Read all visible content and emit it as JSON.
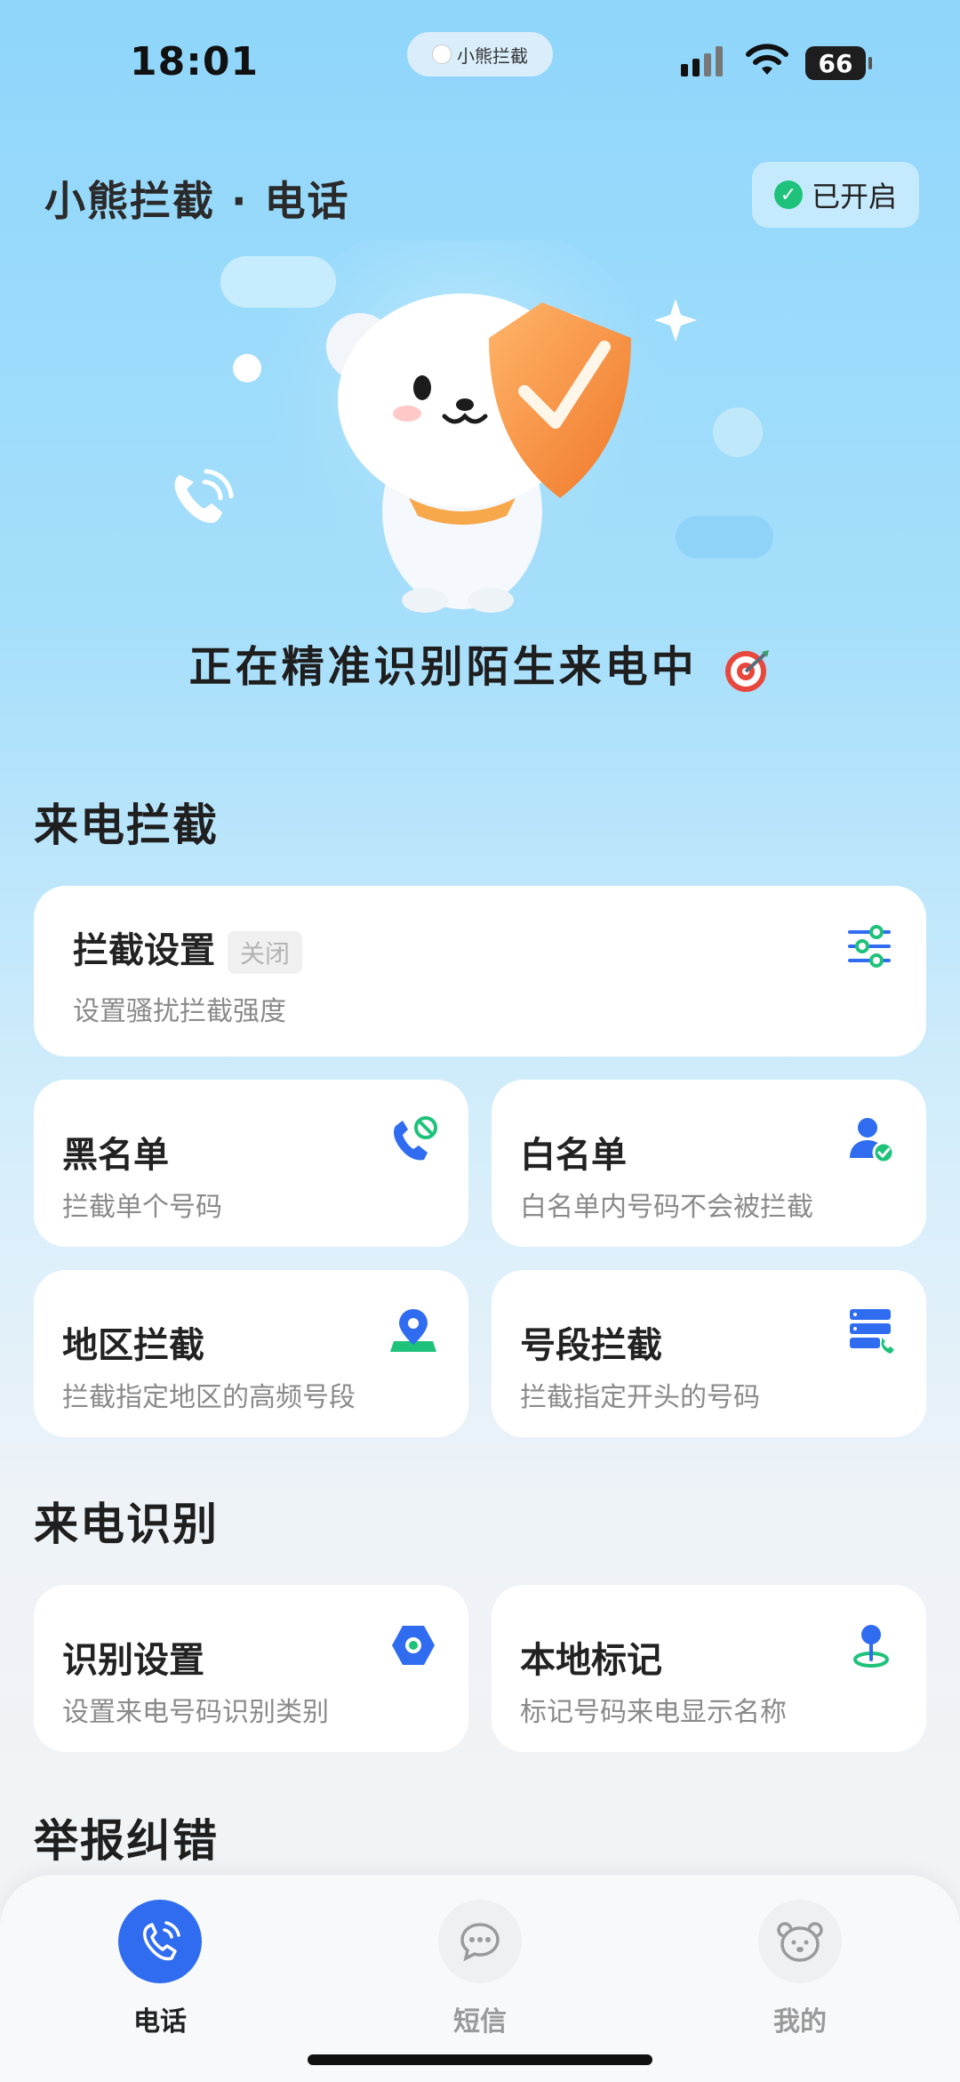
{
  "status_bar": {
    "time": "18:01",
    "pill_label": "小熊拦截",
    "battery": "66"
  },
  "header": {
    "title": "小熊拦截 · 电话",
    "status_badge": "已开启",
    "status_color": "#1ec27a"
  },
  "hero": {
    "message": "正在精准识别陌生来电中"
  },
  "sections": {
    "call_block": "来电拦截",
    "call_identify": "来电识别",
    "report": "举报纠错"
  },
  "cards": {
    "block_settings": {
      "title": "拦截设置",
      "tag": "关闭",
      "subtitle": "设置骚扰拦截强度",
      "icon": "sliders-icon"
    },
    "blacklist": {
      "title": "黑名单",
      "subtitle": "拦截单个号码",
      "icon": "phone-block-icon"
    },
    "whitelist": {
      "title": "白名单",
      "subtitle": "白名单内号码不会被拦截",
      "icon": "user-check-icon"
    },
    "region_block": {
      "title": "地区拦截",
      "subtitle": "拦截指定地区的高频号段",
      "icon": "location-pin-icon"
    },
    "prefix_block": {
      "title": "号段拦截",
      "subtitle": "拦截指定开头的号码",
      "icon": "number-range-icon"
    },
    "identify_settings": {
      "title": "识别设置",
      "subtitle": "设置来电号码识别类别",
      "icon": "hexagon-icon"
    },
    "local_mark": {
      "title": "本地标记",
      "subtitle": "标记号码来电显示名称",
      "icon": "map-marker-icon"
    }
  },
  "tabbar": {
    "items": [
      {
        "label": "电话",
        "icon": "phone-icon",
        "active": true
      },
      {
        "label": "短信",
        "icon": "message-icon",
        "active": false
      },
      {
        "label": "我的",
        "icon": "bear-icon",
        "active": false
      }
    ],
    "active_color": "#2f6cf0",
    "inactive_color": "#9a9a9a"
  },
  "colors": {
    "accent": "#2f6cf0",
    "green": "#1ec27a"
  }
}
